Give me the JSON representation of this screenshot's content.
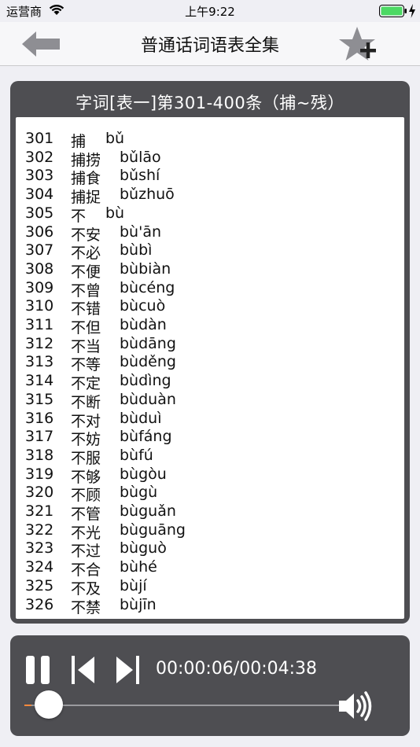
{
  "status_bar": {
    "carrier": "运营商",
    "time": "上午9:22",
    "battery_level": 1.0
  },
  "nav": {
    "title": "普通话词语表全集",
    "back_icon": "arrow-left-icon",
    "favorite_icon": "star-add-icon"
  },
  "list": {
    "title": "字词[表一]第301-400条（捕~残）",
    "rows": [
      {
        "num": "301",
        "hanzi": "捕",
        "pinyin": "bǔ"
      },
      {
        "num": "302",
        "hanzi": "捕捞",
        "pinyin": "bǔlāo"
      },
      {
        "num": "303",
        "hanzi": "捕食",
        "pinyin": "bǔshí"
      },
      {
        "num": "304",
        "hanzi": "捕捉",
        "pinyin": "bǔzhuō"
      },
      {
        "num": "305",
        "hanzi": "不",
        "pinyin": "bù"
      },
      {
        "num": "306",
        "hanzi": "不安",
        "pinyin": "bù'ān"
      },
      {
        "num": "307",
        "hanzi": "不必",
        "pinyin": "bùbì"
      },
      {
        "num": "308",
        "hanzi": "不便",
        "pinyin": "bùbiàn"
      },
      {
        "num": "309",
        "hanzi": "不曾",
        "pinyin": "bùcéng"
      },
      {
        "num": "310",
        "hanzi": "不错",
        "pinyin": "bùcuò"
      },
      {
        "num": "311",
        "hanzi": "不但",
        "pinyin": "bùdàn"
      },
      {
        "num": "312",
        "hanzi": "不当",
        "pinyin": "bùdāng"
      },
      {
        "num": "313",
        "hanzi": "不等",
        "pinyin": "bùděng"
      },
      {
        "num": "314",
        "hanzi": "不定",
        "pinyin": "bùdìng"
      },
      {
        "num": "315",
        "hanzi": "不断",
        "pinyin": "bùduàn"
      },
      {
        "num": "316",
        "hanzi": "不对",
        "pinyin": "bùduì"
      },
      {
        "num": "317",
        "hanzi": "不妨",
        "pinyin": "bùfáng"
      },
      {
        "num": "318",
        "hanzi": "不服",
        "pinyin": "bùfú"
      },
      {
        "num": "319",
        "hanzi": "不够",
        "pinyin": "bùgòu"
      },
      {
        "num": "320",
        "hanzi": "不顾",
        "pinyin": "bùgù"
      },
      {
        "num": "321",
        "hanzi": "不管",
        "pinyin": "bùguǎn"
      },
      {
        "num": "322",
        "hanzi": "不光",
        "pinyin": "bùguāng"
      },
      {
        "num": "323",
        "hanzi": "不过",
        "pinyin": "bùguò"
      },
      {
        "num": "324",
        "hanzi": "不合",
        "pinyin": "bùhé"
      },
      {
        "num": "325",
        "hanzi": "不及",
        "pinyin": "bùjí"
      },
      {
        "num": "326",
        "hanzi": "不禁",
        "pinyin": "bùjīn"
      }
    ]
  },
  "player": {
    "time_display": "00:00:06/00:04:38",
    "progress_fraction": 0.022,
    "pause_icon": "pause-icon",
    "prev_icon": "skip-back-icon",
    "next_icon": "skip-forward-icon",
    "volume_icon": "volume-icon",
    "accent_color": "#ff8a3d"
  }
}
